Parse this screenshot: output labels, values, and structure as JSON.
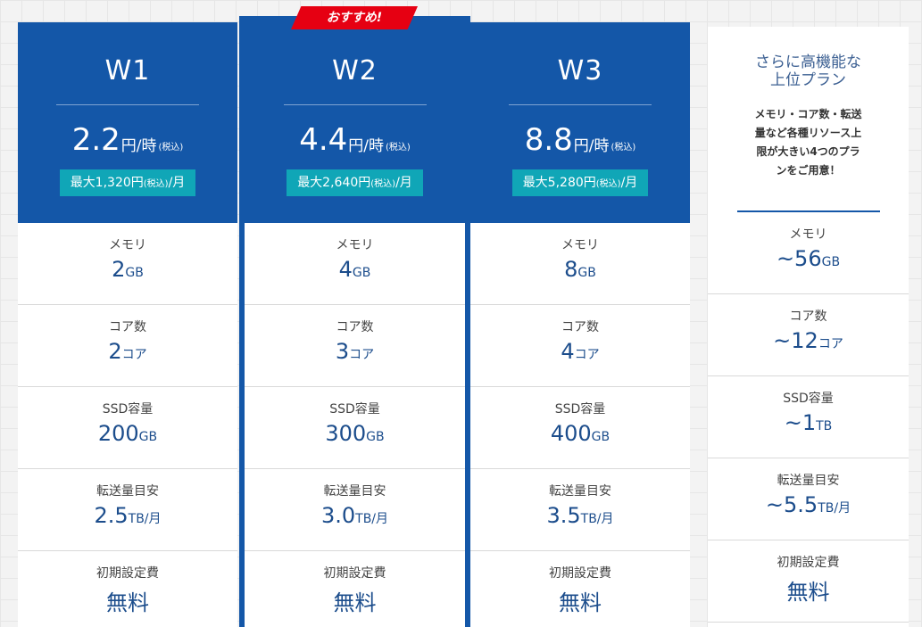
{
  "badge": "おすすめ!",
  "plans": [
    {
      "name": "W1",
      "price": "2.2",
      "price_unit": "円/時",
      "tax": "(税込)",
      "cap_prefix": "最大1,320円",
      "cap_tax": "(税込)",
      "cap_suffix": "/月",
      "memory": "2",
      "memory_unit": "GB",
      "cores": "2",
      "cores_unit": "コア",
      "ssd": "200",
      "ssd_unit": "GB",
      "transfer": "2.5",
      "transfer_unit": "TB/月",
      "setup": "無料"
    },
    {
      "name": "W2",
      "price": "4.4",
      "price_unit": "円/時",
      "tax": "(税込)",
      "cap_prefix": "最大2,640円",
      "cap_tax": "(税込)",
      "cap_suffix": "/月",
      "memory": "4",
      "memory_unit": "GB",
      "cores": "3",
      "cores_unit": "コア",
      "ssd": "300",
      "ssd_unit": "GB",
      "transfer": "3.0",
      "transfer_unit": "TB/月",
      "setup": "無料"
    },
    {
      "name": "W3",
      "price": "8.8",
      "price_unit": "円/時",
      "tax": "(税込)",
      "cap_prefix": "最大5,280円",
      "cap_tax": "(税込)",
      "cap_suffix": "/月",
      "memory": "8",
      "memory_unit": "GB",
      "cores": "4",
      "cores_unit": "コア",
      "ssd": "400",
      "ssd_unit": "GB",
      "transfer": "3.5",
      "transfer_unit": "TB/月",
      "setup": "無料"
    }
  ],
  "higher": {
    "title_line1": "さらに高機能な",
    "title_line2": "上位プラン",
    "desc_line1": "メモリ・コア数・転送",
    "desc_line2": "量など各種リソース上",
    "desc_line3": "限が大きい4つのプラ",
    "desc_line4": "ンをご用意！",
    "tilde": "~",
    "memory": "56",
    "memory_unit": "GB",
    "cores": "12",
    "cores_unit": "コア",
    "ssd": "1",
    "ssd_unit": "TB",
    "transfer": "5.5",
    "transfer_unit": "TB/月",
    "setup": "無料"
  },
  "labels": {
    "memory": "メモリ",
    "cores": "コア数",
    "ssd": "SSD容量",
    "transfer": "転送量目安",
    "setup": "初期設定費"
  }
}
